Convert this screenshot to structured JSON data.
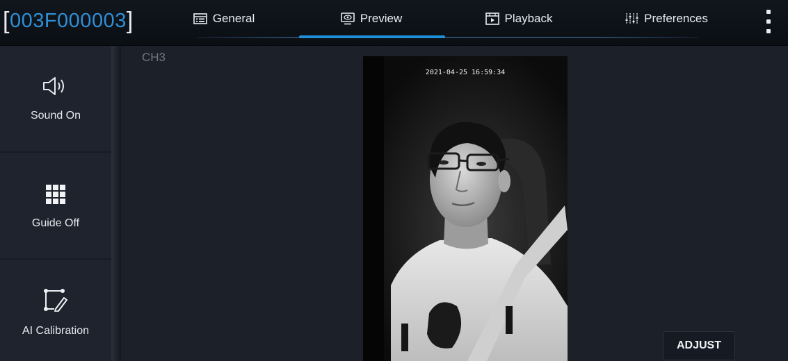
{
  "header": {
    "device_id": "003F000003",
    "bracket_open": "[",
    "bracket_close": "]",
    "tabs": [
      {
        "label": "General",
        "icon": "general-icon"
      },
      {
        "label": "Preview",
        "icon": "preview-icon",
        "active": true
      },
      {
        "label": "Playback",
        "icon": "playback-icon"
      },
      {
        "label": "Preferences",
        "icon": "preferences-icon"
      }
    ],
    "more_icon": "more-vertical-icon"
  },
  "sidebar": {
    "items": [
      {
        "label": "Sound On",
        "icon": "speaker-icon"
      },
      {
        "label": "Guide Off",
        "icon": "grid-icon"
      },
      {
        "label": "AI Calibration",
        "icon": "calibration-icon"
      }
    ]
  },
  "main": {
    "channel_label": "CH3",
    "video_timestamp": "2021-04-25 16:59:34",
    "adjust_label": "ADJUST"
  },
  "colors": {
    "accent": "#1e8fd8",
    "device_id": "#2f8fd6",
    "background": "#1b2029",
    "topbar": "#0b0f14"
  }
}
